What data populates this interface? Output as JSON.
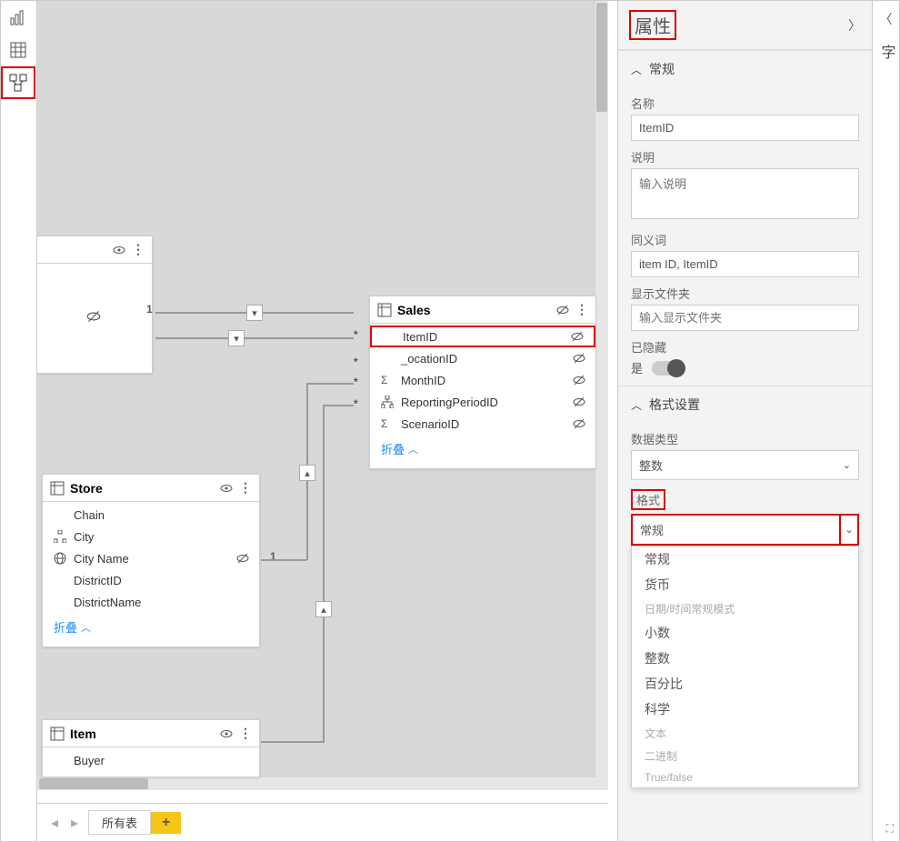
{
  "leftToolbar": {
    "icons": [
      "report-view",
      "data-view",
      "model-view"
    ]
  },
  "canvas": {
    "nodes": {
      "partial": {
        "title": "",
        "fields": []
      },
      "sales": {
        "title": "Sales",
        "fields": [
          {
            "name": "ItemID",
            "hidden": true,
            "selected": true
          },
          {
            "name": "_ocationID",
            "hidden": true
          },
          {
            "name": "MonthID",
            "icon": "Σ",
            "hidden": true
          },
          {
            "name": "ReportingPeriodID",
            "icon": "hier",
            "hidden": true
          },
          {
            "name": "ScenarioID",
            "icon": "Σ",
            "hidden": true
          }
        ],
        "collapse": "折叠"
      },
      "store": {
        "title": "Store",
        "fields": [
          {
            "name": "Chain"
          },
          {
            "name": "City",
            "icon": "hier"
          },
          {
            "name": "City Name",
            "icon": "globe",
            "hidden": true
          },
          {
            "name": "DistrictID"
          },
          {
            "name": "DistrictName"
          }
        ],
        "collapse": "折叠"
      },
      "item": {
        "title": "Item",
        "fields": [
          {
            "name": "Buyer"
          }
        ]
      }
    },
    "cardinality": {
      "one": "1",
      "many": "*"
    }
  },
  "properties": {
    "paneTitle": "属性",
    "general": {
      "section": "常规",
      "nameLabel": "名称",
      "nameValue": "ItemID",
      "descLabel": "说明",
      "descPlaceholder": "输入说明",
      "synLabel": "同义词",
      "synValue": "item ID, ItemID",
      "folderLabel": "显示文件夹",
      "folderPlaceholder": "输入显示文件夹",
      "hiddenLabel": "已隐藏",
      "hiddenValue": "是"
    },
    "format": {
      "section": "格式设置",
      "dataTypeLabel": "数据类型",
      "dataTypeValue": "整数",
      "formatLabel": "格式",
      "formatValue": "常规",
      "options": [
        {
          "label": "常规"
        },
        {
          "label": "货币"
        },
        {
          "label": "日期/时间常规模式",
          "disabled": true
        },
        {
          "label": "小数"
        },
        {
          "label": "整数"
        },
        {
          "label": "百分比"
        },
        {
          "label": "科学"
        },
        {
          "label": "文本",
          "disabled": true
        },
        {
          "label": "二进制",
          "disabled": true
        },
        {
          "label": "True/false",
          "disabled": true
        }
      ]
    }
  },
  "farRight": {
    "label": "字"
  },
  "bottomTabs": {
    "tab1": "所有表",
    "add": "+"
  }
}
